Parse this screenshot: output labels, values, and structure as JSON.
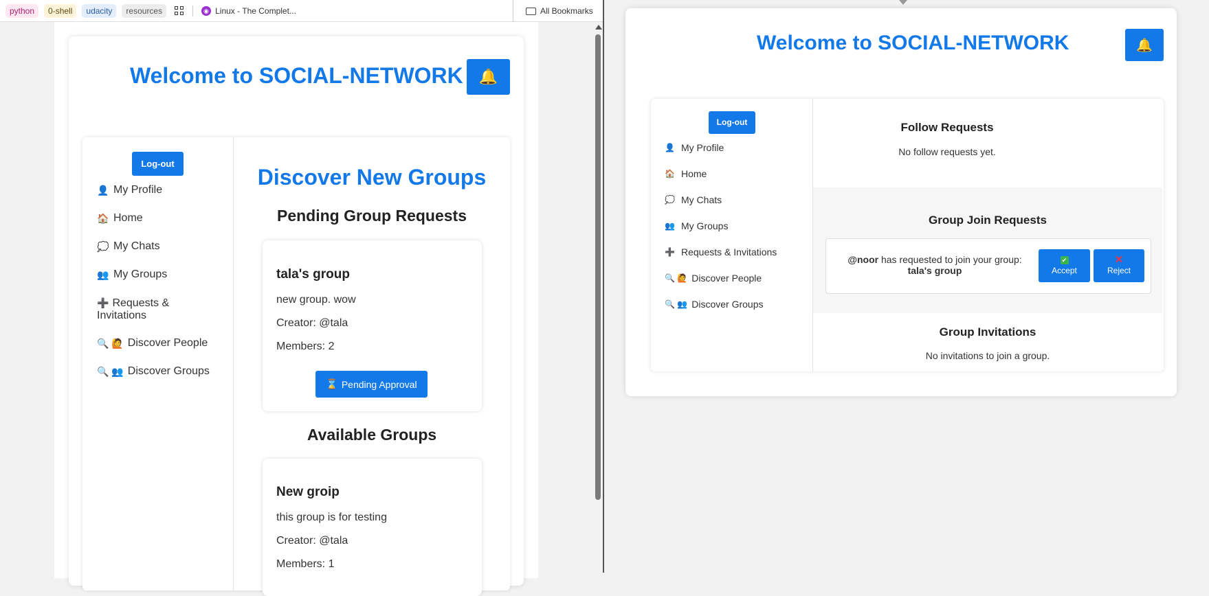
{
  "bookmarks": {
    "chips": [
      "python",
      "0-shell",
      "udacity",
      "resources"
    ],
    "link_label": "Linux - The Complet...",
    "all_label": "All Bookmarks"
  },
  "app": {
    "title": "Welcome to SOCIAL-NETWORK",
    "bell_icon": "🔔",
    "logout_label": "Log-out",
    "nav": [
      {
        "icon": "👤",
        "label": "My Profile"
      },
      {
        "icon": "🏠",
        "label": "Home"
      },
      {
        "icon": "💭",
        "label": "My Chats"
      },
      {
        "icon": "👥",
        "label": "My Groups"
      },
      {
        "icon": "➕",
        "label": "Requests & Invitations"
      },
      {
        "icon": "🔍 🙋",
        "label": "Discover People"
      },
      {
        "icon": "🔍 👥",
        "label": "Discover Groups"
      }
    ]
  },
  "discover": {
    "heading": "Discover New Groups",
    "pending_heading": "Pending Group Requests",
    "pending_groups": [
      {
        "name": "tala's group",
        "description": "new group. wow",
        "creator": "Creator: @tala",
        "members": "Members: 2",
        "button_icon": "⌛",
        "button_label": "Pending Approval"
      }
    ],
    "available_heading": "Available Groups",
    "available_groups": [
      {
        "name": "New groip",
        "description": "this group is for testing",
        "creator": "Creator: @tala",
        "members": "Members: 1"
      }
    ]
  },
  "requests": {
    "follow_heading": "Follow Requests",
    "follow_empty": "No follow requests yet.",
    "group_join_heading": "Group Join Requests",
    "join_requests": [
      {
        "user": "@noor",
        "text": " has requested to join your group:",
        "group": "tala's group",
        "accept_label": "Accept",
        "reject_label": "Reject"
      }
    ],
    "invitations_heading": "Group Invitations",
    "invitations_empty": "No invitations to join a group."
  },
  "colors": {
    "accent": "#1479e8",
    "text": "#333333"
  }
}
